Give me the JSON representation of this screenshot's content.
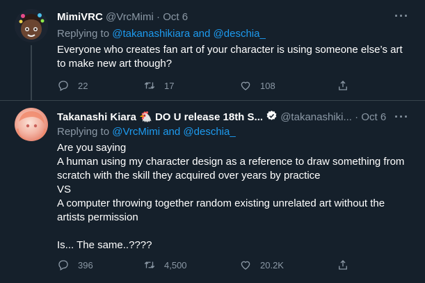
{
  "tweets": [
    {
      "name": "MimiVRC",
      "badge": "",
      "handle": "@VrcMimi",
      "date": "Oct 6",
      "replying_prefix": "Replying to ",
      "replying_to": "@takanashikiara and @deschia_",
      "text": [
        "Everyone who creates fan art of your character is using someone else’s art",
        "to make new art though?"
      ],
      "stats": {
        "replies": "22",
        "retweets": "17",
        "likes": "108"
      }
    },
    {
      "name": "Takanashi Kiara 🐔 DO U release 18th S...",
      "badge": "verified",
      "handle": "@takanashiki...",
      "date": "Oct 6",
      "replying_prefix": "Replying to ",
      "replying_to": "@VrcMimi and @deschia_",
      "text": [
        "Are you saying",
        "A human using my character design as a reference to draw something from",
        "scratch with the skill they acquired over years by practice",
        "VS",
        "A computer throwing together random existing unrelated art without the",
        "artists permission",
        "",
        "Is... The same..????"
      ],
      "stats": {
        "replies": "396",
        "retweets": "4,500",
        "likes": "20.2K"
      }
    }
  ],
  "dot": "·",
  "more_label": "···",
  "icons": [
    "reply-icon",
    "retweet-icon",
    "like-icon",
    "share-icon",
    "verified-icon",
    "more-icon"
  ],
  "colors": {
    "background": "#15202b",
    "text": "#ffffff",
    "muted": "#8b98a5",
    "link": "#1d9bf0",
    "border": "#38444d"
  }
}
